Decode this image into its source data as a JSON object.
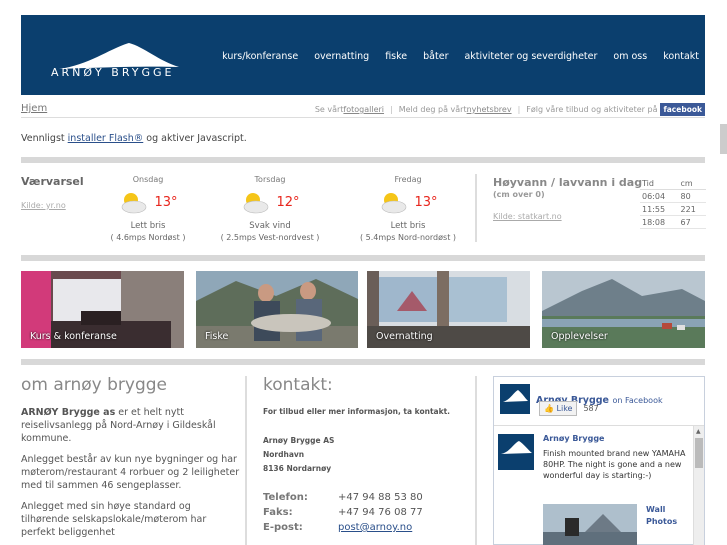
{
  "header": {
    "logo_text": "ARNØY BRYGGE",
    "nav": [
      "kurs/konferanse",
      "overnatting",
      "fiske",
      "båter",
      "aktiviteter og severdigheter",
      "om oss",
      "kontakt"
    ]
  },
  "breadcrumb": {
    "home": "Hjem"
  },
  "toplinks": {
    "gallery_prefix": "Se vårt ",
    "gallery": "fotogalleri",
    "newsletter_prefix": "Meld deg på vårt ",
    "newsletter": "nyhetsbrev",
    "follow": "Følg våre tilbud og aktiviteter på",
    "facebook": "facebook"
  },
  "flash": {
    "prefix": "Vennligst ",
    "link": "installer Flash®",
    "suffix": " og aktiver Javascript."
  },
  "weather": {
    "title": "Værvarsel",
    "source": "Kilde: yr.no",
    "days": [
      {
        "name": "Onsdag",
        "temp": "13°",
        "desc": "Lett bris",
        "wind": "( 4.6mps Nordøst )",
        "icon": "partly-cloudy-icon"
      },
      {
        "name": "Torsdag",
        "temp": "12°",
        "desc": "Svak vind",
        "wind": "( 2.5mps Vest-nordvest )",
        "icon": "partly-cloudy-icon"
      },
      {
        "name": "Fredag",
        "temp": "13°",
        "desc": "Lett bris",
        "wind": "( 5.4mps Nord-nordøst )",
        "icon": "partly-cloudy-icon"
      }
    ]
  },
  "tide": {
    "title": "Høyvann / lavvann i dag",
    "subtitle": "(cm over 0)",
    "source": "Kilde: statkart.no",
    "headers": [
      "Tid",
      "cm"
    ],
    "rows": [
      [
        "06:04",
        "80"
      ],
      [
        "11:55",
        "221"
      ],
      [
        "18:08",
        "67"
      ]
    ]
  },
  "tiles": [
    {
      "label": "Kurs & konferanse"
    },
    {
      "label": "Fiske"
    },
    {
      "label": "Overnatting"
    },
    {
      "label": "Opplevelser"
    }
  ],
  "about": {
    "title": "om arnøy brygge",
    "p1_bold": "ARNØY Brygge as",
    "p1": " er et helt nytt reiselivsanlegg på Nord-Arnøy i Gildeskål kommune.",
    "p2": "Anlegget består av kun nye bygninger og har møterom/restaurant 4 rorbuer og 2 leiligheter med til sammen 46 sengeplasser.",
    "p3": "Anlegget med sin høye standard og tilhørende selskapslokale/møterom har perfekt beliggenhet"
  },
  "contact": {
    "title": "kontakt:",
    "intro": "For tilbud eller mer informasjon, ta kontakt.",
    "company": "Arnøy Brygge AS",
    "street": "Nordhavn",
    "city": "8136 Nordarnøy",
    "phone_label": "Telefon:",
    "phone": "+47 94 88 53 80",
    "fax_label": "Faks:",
    "fax": "+47 94 76 08 77",
    "email_label": "E-post:",
    "email": "post@arnoy.no"
  },
  "facebook_box": {
    "page_name": "Arnøy Brygge",
    "on_facebook": "on Facebook",
    "like": "Like",
    "like_count": "587",
    "post_author": "Arnøy Brygge",
    "post_text": "Finish mounted brand new YAMAHA 80HP. The night is gone and a new wonderful day is starting:-)",
    "wall_photos": "Wall Photos"
  },
  "colors": {
    "header_bg": "#0b3f6e",
    "temp_red": "#e8261d",
    "facebook_blue": "#3b5998"
  }
}
